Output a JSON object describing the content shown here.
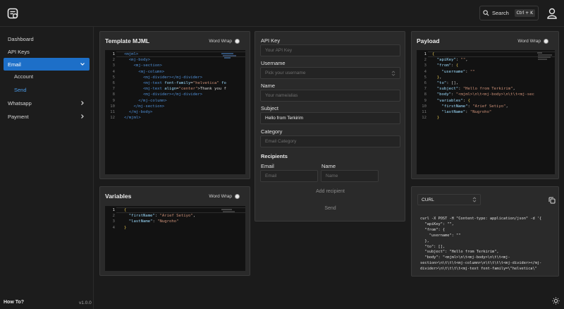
{
  "header": {
    "search_label": "Search",
    "search_shortcut": "Ctrl + K"
  },
  "sidebar": {
    "items": [
      {
        "label": "Dashboard"
      },
      {
        "label": "API Keys"
      },
      {
        "label": "Email"
      },
      {
        "label": "Whatsapp"
      },
      {
        "label": "Payment"
      }
    ],
    "email_sub": [
      {
        "label": "Account"
      },
      {
        "label": "Send"
      }
    ],
    "footer_link": "How To?",
    "version": "v1.0.0"
  },
  "template_panel": {
    "title": "Template MJML",
    "word_wrap": "Word Wrap",
    "line_numbers": [
      "1",
      "2",
      "3",
      "4",
      "5",
      "6",
      "7",
      "8",
      "9",
      "10",
      "11",
      "12"
    ]
  },
  "variables_panel": {
    "title": "Variables",
    "word_wrap": "Word Wrap",
    "line_numbers": [
      "1",
      "2",
      "3",
      "4"
    ],
    "first_name_key": "\"firstName\"",
    "first_name_value": "\"Arief Setiyo\"",
    "last_name_key": "\"lastName\"",
    "last_name_value": "\"Nugroho\""
  },
  "form": {
    "api_key": {
      "label": "API Key",
      "placeholder": "Your API Key",
      "value": ""
    },
    "username": {
      "label": "Username",
      "placeholder": "Pick your username"
    },
    "name": {
      "label": "Name",
      "placeholder": "Your name/alias",
      "value": ""
    },
    "subject": {
      "label": "Subject",
      "placeholder": "Subject",
      "value": "Hello from Terkirim"
    },
    "category": {
      "label": "Category",
      "placeholder": "Email Category",
      "value": ""
    },
    "recipients": {
      "title": "Recipients",
      "email_label": "Email",
      "email_placeholder": "Email",
      "name_label": "Name",
      "name_placeholder": "Name"
    },
    "add_recipient": "Add recipient",
    "send": "Send"
  },
  "payload_panel": {
    "title": "Payload",
    "word_wrap": "Word Wrap",
    "line_numbers": [
      "1",
      "2",
      "3",
      "4",
      "5",
      "6",
      "7",
      "8",
      "9",
      "10",
      "11",
      "12"
    ],
    "api_key_key": "\"apiKey\"",
    "api_key_value": "\"\"",
    "from_key": "\"from\"",
    "username_key": "\"username\"",
    "username_value": "\"\"",
    "to_key": "\"to\"",
    "to_value": "[]",
    "subject_key": "\"subject\"",
    "subject_value": "\"Hello from Terkirim\"",
    "body_key": "\"body\"",
    "body_value": "\"<mjml>\\n\\t<mj-body>\\n\\t\\t<mj-sec",
    "variables_key": "\"variables\"",
    "first_name_key": "\"firstName\"",
    "first_name_value": "\"Arief Setiyo\"",
    "last_name_key": "\"lastName\"",
    "last_name_value": "\"Nugroho\""
  },
  "curl_panel": {
    "language": "CURL",
    "code": "curl -X POST -H \"Content-type: application/json\" -d '{\n  \"apiKey\": \"\",\n  \"from\": {\n    \"username\": \"\"\n  },\n  \"to\": [],\n  \"subject\": \"Hello from Terkirim\",\n  \"body\": \"<mjml>\\n\\t<mj-body>\\n\\t\\t<mj-\nsection>\\n\\t\\t\\t<mj-column>\\n\\t\\t\\t\\t<mj-divider></mj-\ndivider>\\n\\t\\t\\t\\t<mj-text font-family=\\\"helvetica\\\""
  }
}
